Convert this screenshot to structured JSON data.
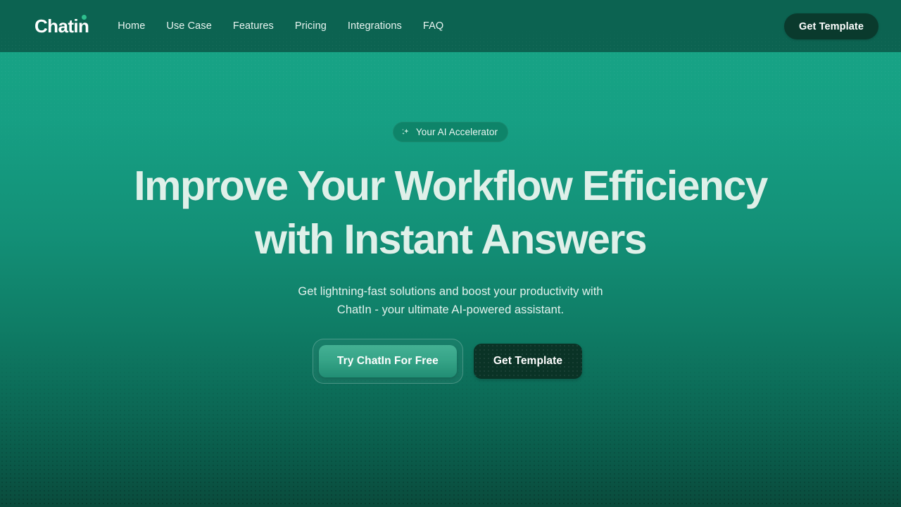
{
  "brand": {
    "name": "Chatin",
    "dot_color": "#2ec08e"
  },
  "header": {
    "nav": [
      {
        "label": "Home"
      },
      {
        "label": "Use Case"
      },
      {
        "label": "Features"
      },
      {
        "label": "Pricing"
      },
      {
        "label": "Integrations"
      },
      {
        "label": "FAQ"
      }
    ],
    "cta_label": "Get Template",
    "background_color": "#0c6351"
  },
  "hero": {
    "badge": {
      "label": "Your AI Accelerator",
      "icon": "sparkles-icon",
      "background_color": "#0e8469"
    },
    "headline": {
      "line1": "Improve Your Workflow Efficiency",
      "line2": "with Instant Answers",
      "color": "#dff0e9"
    },
    "subcopy": {
      "line1": "Get lightning-fast solutions and boost your productivity with",
      "line2": "ChatIn - your ultimate AI-powered assistant."
    },
    "primary_cta": {
      "label": "Try ChatIn For Free",
      "background_color": "#2ea183"
    },
    "secondary_cta": {
      "label": "Get Template",
      "background_color": "#0a3326"
    },
    "gradient_top": "#17a385",
    "gradient_bottom": "#0a4b3c"
  }
}
